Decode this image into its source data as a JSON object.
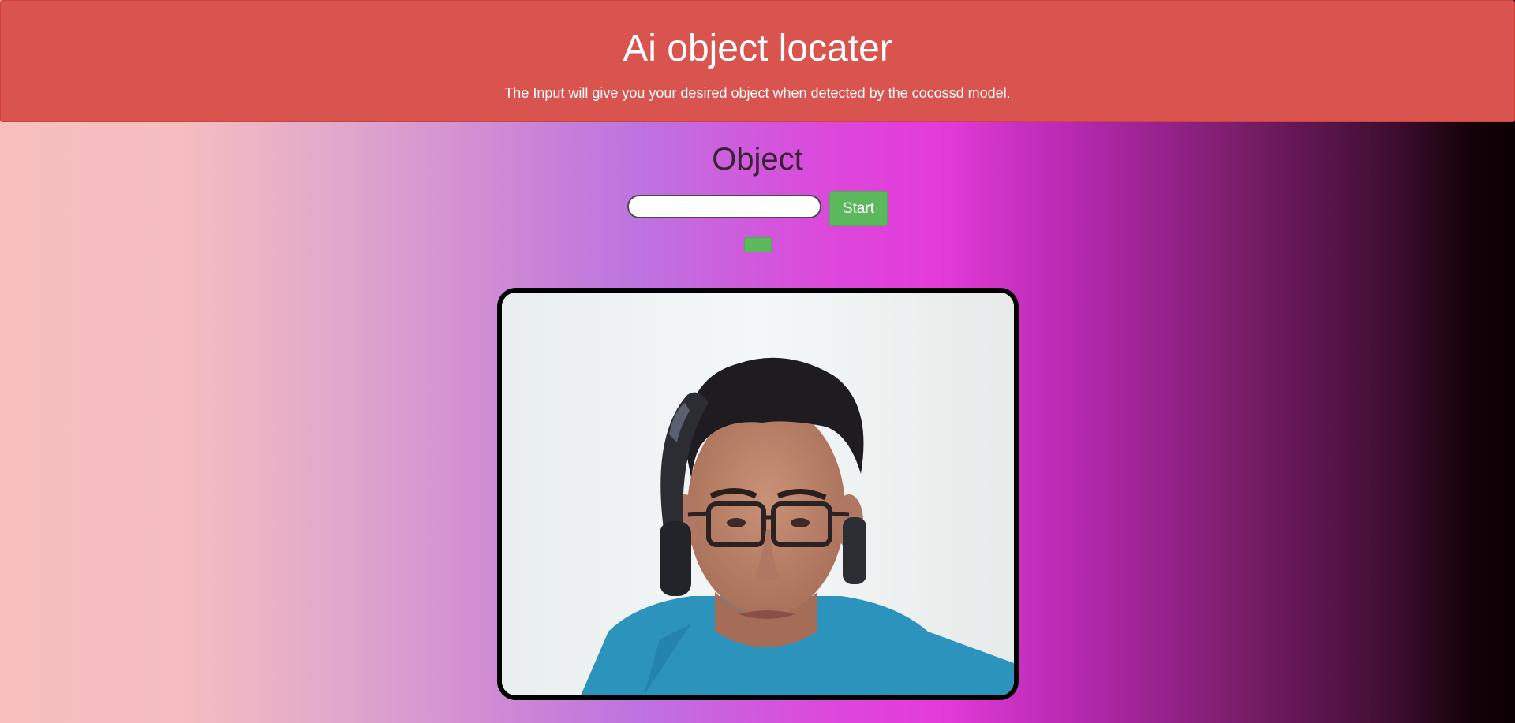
{
  "header": {
    "title": "Ai object locater",
    "subtitle": "The Input will give you your desired object when detected by the cocossd model."
  },
  "main": {
    "section_title": "Object",
    "search_input": {
      "value": "",
      "placeholder": ""
    },
    "start_button_label": "Start",
    "secondary_button_label": ""
  },
  "video": {
    "description_icon": "webcam-feed"
  },
  "colors": {
    "header_bg": "#d9534f",
    "button_green": "#5cb85c",
    "title_text": "#3a2330"
  }
}
